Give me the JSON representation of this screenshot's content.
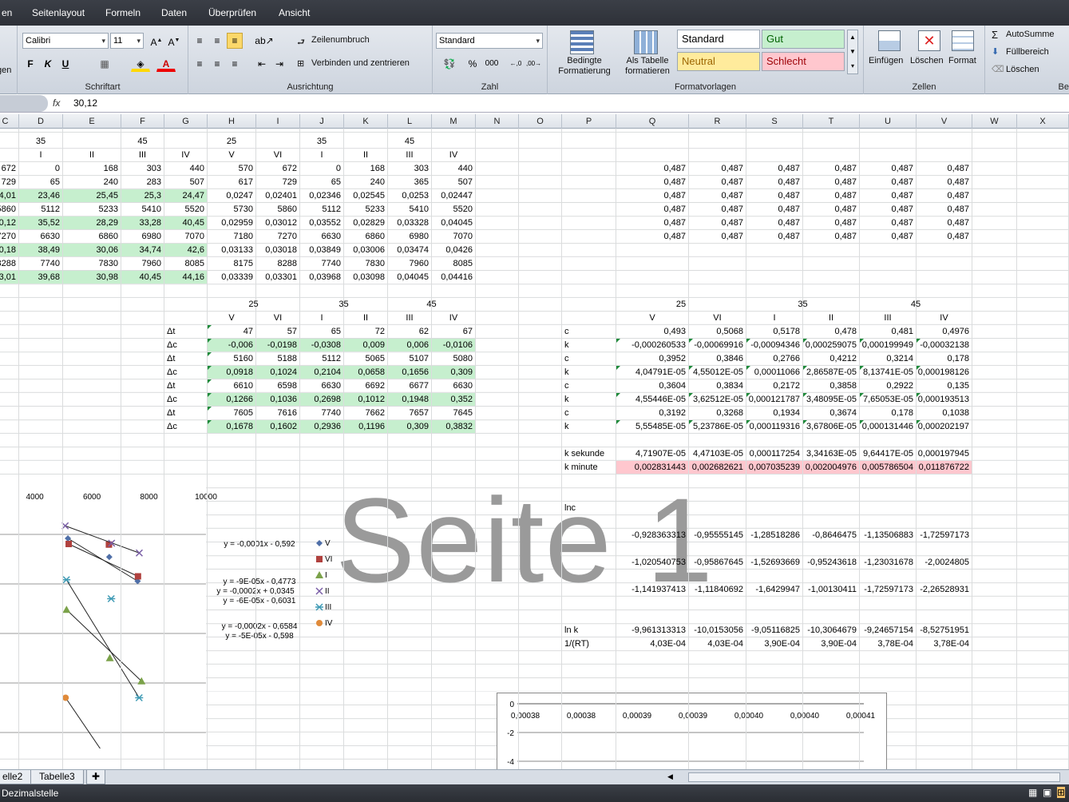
{
  "menu": {
    "tabs": [
      "en",
      "Seitenlayout",
      "Formeln",
      "Daten",
      "Überprüfen",
      "Ansicht"
    ]
  },
  "ribbon": {
    "font": {
      "name": "Calibri",
      "size": "11",
      "group_label": "Schriftart",
      "bold": "F",
      "italic": "K",
      "underline": "U"
    },
    "align": {
      "wrap": "Zeilenumbruch",
      "merge": "Verbinden und zentrieren",
      "group_label": "Ausrichtung"
    },
    "number": {
      "format": "Standard",
      "percent": "%",
      "thousands": "000",
      "group_label": "Zahl"
    },
    "styles": {
      "cond": "Bedingte Formatierung",
      "table": "Als Tabelle formatieren",
      "standard": "Standard",
      "gut": "Gut",
      "neutral": "Neutral",
      "schlecht": "Schlecht",
      "group_label": "Formatvorlagen"
    },
    "cells": {
      "insert": "Einfügen",
      "delete": "Löschen",
      "format": "Format",
      "group_label": "Zellen"
    },
    "edit": {
      "autosum": "AutoSumme",
      "fill": "Füllbereich",
      "clear": "Löschen",
      "group_label": "Be"
    },
    "left_cut": "gen"
  },
  "formula": {
    "fx": "fx",
    "value": "30,12"
  },
  "columns": [
    "C",
    "D",
    "E",
    "F",
    "G",
    "H",
    "I",
    "J",
    "K",
    "L",
    "M",
    "N",
    "O",
    "P",
    "Q",
    "R",
    "S",
    "T",
    "U",
    "V",
    "W",
    "X"
  ],
  "cells": [
    {
      "col": 1,
      "row": 1,
      "v": "35",
      "a": "c"
    },
    {
      "col": 3,
      "row": 1,
      "v": "45",
      "a": "c"
    },
    {
      "col": 5,
      "row": 1,
      "v": "25",
      "a": "c"
    },
    {
      "col": 7,
      "row": 1,
      "v": "35",
      "a": "c"
    },
    {
      "col": 9,
      "row": 1,
      "v": "45",
      "a": "c"
    },
    {
      "col": 0,
      "row": 2,
      "v": "I",
      "a": "l"
    },
    {
      "col": 1,
      "row": 2,
      "v": "I",
      "a": "c"
    },
    {
      "col": 2,
      "row": 2,
      "v": "II",
      "a": "c"
    },
    {
      "col": 3,
      "row": 2,
      "v": "III",
      "a": "c"
    },
    {
      "col": 4,
      "row": 2,
      "v": "IV",
      "a": "c"
    },
    {
      "col": 5,
      "row": 2,
      "v": "V",
      "a": "c"
    },
    {
      "col": 6,
      "row": 2,
      "v": "VI",
      "a": "c"
    },
    {
      "col": 7,
      "row": 2,
      "v": "I",
      "a": "c"
    },
    {
      "col": 8,
      "row": 2,
      "v": "II",
      "a": "c"
    },
    {
      "col": 9,
      "row": 2,
      "v": "III",
      "a": "c"
    },
    {
      "col": 10,
      "row": 2,
      "v": "IV",
      "a": "c"
    }
  ],
  "rows_main": [
    {
      "row": 3,
      "vals": [
        "672",
        "0",
        "168",
        "303",
        "440",
        "570",
        "672",
        "0",
        "168",
        "303",
        "440"
      ],
      "g": false
    },
    {
      "row": 4,
      "vals": [
        "729",
        "65",
        "240",
        "283",
        "507",
        "617",
        "729",
        "65",
        "240",
        "365",
        "507"
      ],
      "g": false
    },
    {
      "row": 5,
      "vals": [
        "24,01",
        "23,46",
        "25,45",
        "25,3",
        "24,47",
        "0,0247",
        "0,02401",
        "0,02346",
        "0,02545",
        "0,0253",
        "0,02447"
      ],
      "g": true
    },
    {
      "row": 6,
      "vals": [
        "5860",
        "5112",
        "5233",
        "5410",
        "5520",
        "5730",
        "5860",
        "5112",
        "5233",
        "5410",
        "5520"
      ],
      "g": false
    },
    {
      "row": 7,
      "vals": [
        "30,12",
        "35,52",
        "28,29",
        "33,28",
        "40,45",
        "0,02959",
        "0,03012",
        "0,03552",
        "0,02829",
        "0,03328",
        "0,04045"
      ],
      "g": true
    },
    {
      "row": 8,
      "vals": [
        "7270",
        "6630",
        "6860",
        "6980",
        "7070",
        "7180",
        "7270",
        "6630",
        "6860",
        "6980",
        "7070"
      ],
      "g": false
    },
    {
      "row": 9,
      "vals": [
        "30,18",
        "38,49",
        "30,06",
        "34,74",
        "42,6",
        "0,03133",
        "0,03018",
        "0,03849",
        "0,03006",
        "0,03474",
        "0,0426"
      ],
      "g": true
    },
    {
      "row": 10,
      "vals": [
        "8288",
        "7740",
        "7830",
        "7960",
        "8085",
        "8175",
        "8288",
        "7740",
        "7830",
        "7960",
        "8085"
      ],
      "g": false
    },
    {
      "row": 11,
      "vals": [
        "33,01",
        "39,68",
        "30,98",
        "40,45",
        "44,16",
        "0,03339",
        "0,03301",
        "0,03968",
        "0,03098",
        "0,04045",
        "0,04416"
      ],
      "g": true
    }
  ],
  "delta_hdr1": [
    "25",
    "35",
    "45"
  ],
  "delta_hdr2": [
    "V",
    "VI",
    "I",
    "II",
    "III",
    "IV"
  ],
  "delta_rows": [
    {
      "label": "Δt",
      "vals": [
        "47",
        "57",
        "65",
        "72",
        "62",
        "67"
      ],
      "g": false
    },
    {
      "label": "Δc",
      "vals": [
        "-0,006",
        "-0,0198",
        "-0,0308",
        "0,009",
        "0,006",
        "-0,0106"
      ],
      "g": true
    },
    {
      "label": "Δt",
      "vals": [
        "5160",
        "5188",
        "5112",
        "5065",
        "5107",
        "5080"
      ],
      "g": false
    },
    {
      "label": "Δc",
      "vals": [
        "0,0918",
        "0,1024",
        "0,2104",
        "0,0658",
        "0,1656",
        "0,309"
      ],
      "g": true
    },
    {
      "label": "Δt",
      "vals": [
        "6610",
        "6598",
        "6630",
        "6692",
        "6677",
        "6630"
      ],
      "g": false
    },
    {
      "label": "Δc",
      "vals": [
        "0,1266",
        "0,1036",
        "0,2698",
        "0,1012",
        "0,1948",
        "0,352"
      ],
      "g": true
    },
    {
      "label": "Δt",
      "vals": [
        "7605",
        "7616",
        "7740",
        "7662",
        "7657",
        "7645"
      ],
      "g": false
    },
    {
      "label": "Δc",
      "vals": [
        "0,1678",
        "0,1602",
        "0,2936",
        "0,1196",
        "0,309",
        "0,3832"
      ],
      "g": true
    }
  ],
  "right_const": "0,487",
  "right_hdr1": [
    "25",
    "35",
    "45"
  ],
  "right_hdr2": [
    "V",
    "VI",
    "I",
    "II",
    "III",
    "IV"
  ],
  "ck_rows": [
    {
      "label": "c",
      "vals": [
        "0,493",
        "0,5068",
        "0,5178",
        "0,478",
        "0,481",
        "0,4976"
      ]
    },
    {
      "label": "k",
      "vals": [
        "-0,000260533",
        "-0,00069916",
        "-0,00094346",
        "0,000259075",
        "0,000199949",
        "-0,00032138"
      ]
    },
    {
      "label": "c",
      "vals": [
        "0,3952",
        "0,3846",
        "0,2766",
        "0,4212",
        "0,3214",
        "0,178"
      ]
    },
    {
      "label": "k",
      "vals": [
        "4,04791E-05",
        "4,55012E-05",
        "0,00011066",
        "2,86587E-05",
        "8,13741E-05",
        "0,000198126"
      ]
    },
    {
      "label": "c",
      "vals": [
        "0,3604",
        "0,3834",
        "0,2172",
        "0,3858",
        "0,2922",
        "0,135"
      ]
    },
    {
      "label": "k",
      "vals": [
        "4,55446E-05",
        "3,62512E-05",
        "0,000121787",
        "3,48095E-05",
        "7,65053E-05",
        "0,000193513"
      ]
    },
    {
      "label": "c",
      "vals": [
        "0,3192",
        "0,3268",
        "0,1934",
        "0,3674",
        "0,178",
        "0,1038"
      ]
    },
    {
      "label": "k",
      "vals": [
        "5,55485E-05",
        "5,23786E-05",
        "0,000119316",
        "3,67806E-05",
        "0,000131446",
        "0,000202197"
      ]
    }
  ],
  "k_sec": {
    "label": "k sekunde",
    "vals": [
      "4,71907E-05",
      "4,47103E-05",
      "0,000117254",
      "3,34163E-05",
      "9,64417E-05",
      "0,000197945"
    ]
  },
  "k_min": {
    "label": "k minute",
    "vals": [
      "0,002831443",
      "0,002682621",
      "0,007035239",
      "0,002004976",
      "0,005786504",
      "0,011876722"
    ]
  },
  "lnc_label": "lnc",
  "lnc_rows": [
    [
      "-0,928363313",
      "-0,95555145",
      "-1,28518286",
      "-0,8646475",
      "-1,13506883",
      "-1,72597173"
    ],
    [
      "-1,020540753",
      "-0,95867645",
      "-1,52693669",
      "-0,95243618",
      "-1,23031678",
      "-2,0024805"
    ],
    [
      "-1,141937413",
      "-1,11840692",
      "-1,6429947",
      "-1,00130411",
      "-1,72597173",
      "-2,26528931"
    ]
  ],
  "lnk": {
    "label": "ln k",
    "vals": [
      "-9,961313313",
      "-10,0153056",
      "-9,05116825",
      "-10,3064679",
      "-9,24657154",
      "-8,52751951"
    ]
  },
  "rt": {
    "label": "1/(RT)",
    "vals": [
      "4,03E-04",
      "4,03E-04",
      "3,90E-04",
      "3,90E-04",
      "3,78E-04",
      "3,78E-04"
    ]
  },
  "watermark": "Seite 1",
  "chart_data": [
    {
      "type": "scatter",
      "x_ticks": [
        "4000",
        "6000",
        "8000",
        "10000"
      ],
      "xlim": [
        2500,
        10000
      ],
      "ylim": [
        -1.9,
        -0.7
      ],
      "series": [
        {
          "name": "V",
          "marker": "diamond",
          "color": "#4f6fa8",
          "x": [
            5160,
            6610,
            7605
          ],
          "y": [
            -0.928,
            -1.021,
            -1.142
          ]
        },
        {
          "name": "VI",
          "marker": "square",
          "color": "#b0413e",
          "x": [
            5188,
            6598,
            7616
          ],
          "y": [
            -0.956,
            -0.959,
            -1.118
          ]
        },
        {
          "name": "I",
          "marker": "triangle",
          "color": "#7ba24a",
          "x": [
            5112,
            6630,
            7740
          ],
          "y": [
            -1.285,
            -1.527,
            -1.643
          ]
        },
        {
          "name": "II",
          "marker": "x",
          "color": "#7a5ea6",
          "x": [
            5065,
            6692,
            7662
          ],
          "y": [
            -0.865,
            -0.952,
            -1.001
          ]
        },
        {
          "name": "III",
          "marker": "star",
          "color": "#3f9bb5",
          "x": [
            5107,
            6677,
            7657
          ],
          "y": [
            -1.135,
            -1.23,
            -1.726
          ]
        },
        {
          "name": "IV",
          "marker": "circle",
          "color": "#e08a3a",
          "x": [
            5080,
            6630,
            7645
          ],
          "y": [
            -1.726,
            -2.002,
            -2.265
          ]
        }
      ],
      "equations": [
        "y = -0,0001x - 0,592",
        "y = -9E-05x - 0,4773",
        "y = -0,0002x + 0,0345",
        "y = -6E-05x - 0,6031",
        "y = -0,0002x - 0,6584",
        "y = -5E-05x - 0,598"
      ]
    },
    {
      "type": "scatter",
      "x_ticks": [
        "0,00038",
        "0,00038",
        "0,00039",
        "0,00039",
        "0,00040",
        "0,00040",
        "0,00041"
      ],
      "y_ticks": [
        "0",
        "-2",
        "-4"
      ]
    }
  ],
  "sheet_tabs": [
    "elle2",
    "Tabelle3"
  ],
  "status": {
    "text": "Dezimalstelle"
  },
  "colors": {
    "green_fill": "#c6efce",
    "red_fill": "#ffc7ce",
    "gut": "#c6efce",
    "neutral": "#ffeb9c",
    "schlecht": "#ffc7ce"
  }
}
